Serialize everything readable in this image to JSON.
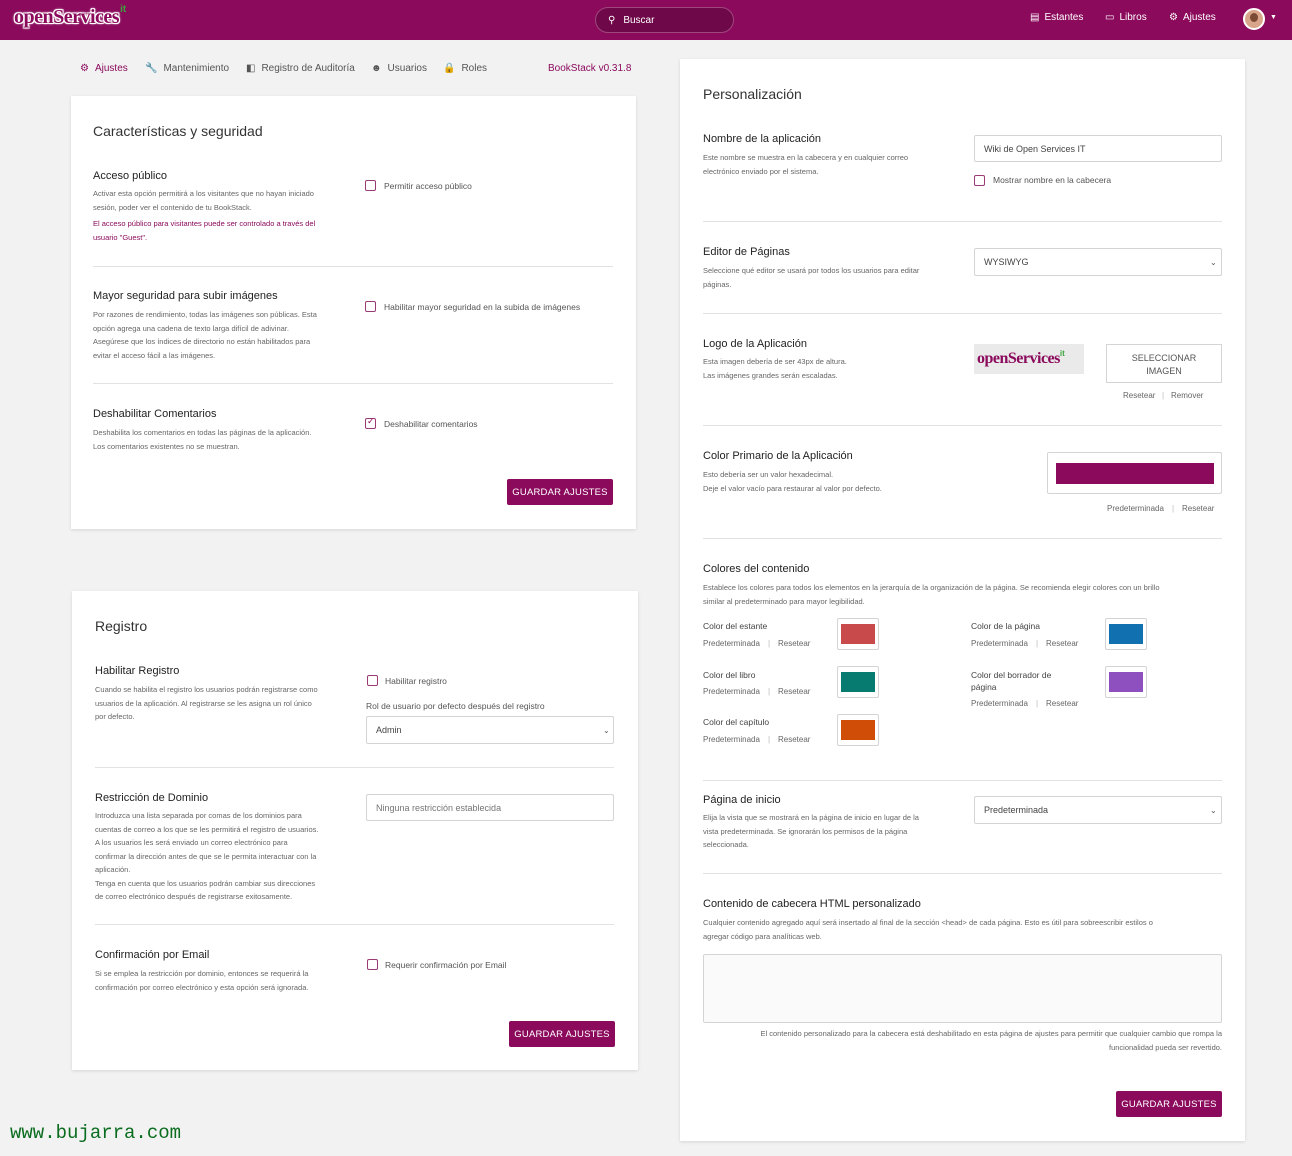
{
  "header": {
    "logo_text": "openServices",
    "logo_suffix": "it",
    "search_placeholder": "Buscar",
    "nav": [
      {
        "label": "Estantes",
        "icon": "shelves-icon"
      },
      {
        "label": "Libros",
        "icon": "books-icon"
      },
      {
        "label": "Ajustes",
        "icon": "gear-icon"
      }
    ]
  },
  "settings_nav": {
    "items": [
      {
        "label": "Ajustes",
        "icon": "gear-icon"
      },
      {
        "label": "Mantenimiento",
        "icon": "wrench-icon"
      },
      {
        "label": "Registro de Auditoría",
        "icon": "audit-log-icon"
      },
      {
        "label": "Usuarios",
        "icon": "users-icon"
      },
      {
        "label": "Roles",
        "icon": "lock-icon"
      }
    ],
    "version": "BookStack v0.31.8"
  },
  "features": {
    "title": "Características y seguridad",
    "public_access": {
      "title": "Acceso público",
      "desc": [
        "Activar esta opción permitirá a los visitantes que no hayan iniciado",
        "sesión, poder ver el contenido de tu BookStack."
      ],
      "note": [
        "El acceso público para visitantes puede ser controlado a través del",
        "usuario \"Guest\"."
      ],
      "checkbox_label": "Permitir acceso público",
      "checked": false
    },
    "image_security": {
      "title": "Mayor seguridad para subir imágenes",
      "desc": [
        "Por razones de rendimiento, todas las imágenes son públicas. Esta",
        "opción agrega una cadena de texto larga difícil de adivinar.",
        "Asegúrese que los índices de directorio no están habilitados para",
        "evitar el acceso fácil a las imágenes."
      ],
      "checkbox_label": "Habilitar mayor seguridad en la subida de imágenes",
      "checked": false
    },
    "disable_comments": {
      "title": "Deshabilitar Comentarios",
      "desc": [
        "Deshabilita los comentarios en todas las páginas de la aplicación.",
        "Los comentarios existentes no se muestran."
      ],
      "checkbox_label": "Deshabilitar comentarios",
      "checked": true
    },
    "save_label": "GUARDAR AJUSTES"
  },
  "registration": {
    "title": "Registro",
    "enable": {
      "title": "Habilitar Registro",
      "desc": [
        "Cuando se habilita el registro los usuarios podrán registrarse como",
        "usuarios de la aplicación. Al registrarse se les asigna un rol único",
        "por defecto."
      ],
      "checkbox_label": "Habilitar registro",
      "checked": false,
      "role_label": "Rol de usuario por defecto después del registro",
      "role_value": "Admin"
    },
    "domain": {
      "title": "Restricción de Dominio",
      "desc": [
        "Introduzca una lista separada por comas de los dominios para",
        "cuentas de correo a los que se les permitirá el registro de usuarios.",
        "A los usuarios les será enviado un correo electrónico para",
        "confirmar la dirección antes de que se le permita interactuar con la",
        "aplicación.",
        "Tenga en cuenta que los usuarios podrán cambiar sus direcciones",
        "de correo electrónico después de registrarse exitosamente."
      ],
      "placeholder": "Ninguna restricción establecida"
    },
    "email_confirm": {
      "title": "Confirmación por Email",
      "desc": [
        "Si se emplea la restricción por dominio, entonces se requerirá la",
        "confirmación por correo electrónico y esta opción será ignorada."
      ],
      "checkbox_label": "Requerir confirmación por Email",
      "checked": false
    },
    "save_label": "GUARDAR AJUSTES"
  },
  "customization": {
    "title": "Personalización",
    "app_name": {
      "title": "Nombre de la aplicación",
      "desc": [
        "Este nombre se muestra en la cabecera y en cualquier correo",
        "electrónico enviado por el sistema."
      ],
      "value": "Wiki de Open Services IT",
      "checkbox_label": "Mostrar nombre en la cabecera",
      "checked": false
    },
    "editor": {
      "title": "Editor de Páginas",
      "desc": [
        "Seleccione qué editor se usará por todos los usuarios para editar",
        "páginas."
      ],
      "value": "WYSIWYG"
    },
    "logo": {
      "title": "Logo de la Aplicación",
      "desc": [
        "Esta imagen debería de ser 43px de altura.",
        "Las imágenes grandes serán escaladas."
      ],
      "select_label": [
        "SELECCIONAR",
        "IMAGEN"
      ],
      "reset_label": "Resetear",
      "remove_label": "Remover"
    },
    "primary_color": {
      "title": "Color Primario de la Aplicación",
      "desc": [
        "Esto debería ser un valor hexadecimal.",
        "Deje el valor vacío para restaurar al valor por defecto."
      ],
      "color": "#8b0a5c",
      "default_label": "Predeterminada",
      "reset_label": "Resetear"
    },
    "content_colors": {
      "title": "Colores del contenido",
      "desc": [
        "Establece los colores para todos los elementos en la jerarquía de la organización de la página. Se recomienda elegir colores con un brillo",
        "similar al predeterminado para mayor legibilidad."
      ],
      "default_label": "Predeterminada",
      "reset_label": "Resetear",
      "items": [
        {
          "label": [
            "Color del estante"
          ],
          "color": "#c94a4a"
        },
        {
          "label": [
            "Color de la página"
          ],
          "color": "#1070b0"
        },
        {
          "label": [
            "Color del libro"
          ],
          "color": "#077b70"
        },
        {
          "label": [
            "Color del borrador de",
            "página"
          ],
          "color": "#8e4fbf"
        },
        {
          "label": [
            "Color del capítulo"
          ],
          "color": "#cf4d06"
        }
      ]
    },
    "homepage": {
      "title": "Página de inicio",
      "desc": [
        "Elija la vista que se mostrará en la página de inicio en lugar de la",
        "vista predeterminada. Se ignorarán los permisos de la página",
        "seleccionada."
      ],
      "value": "Predeterminada"
    },
    "custom_head": {
      "title": "Contenido de cabecera HTML personalizado",
      "desc": [
        "Cualquier contenido agregado aquí será insertado al final de la sección <head> de cada página. Esto es útil para sobreescribir estilos o",
        "agregar código para analíticas web."
      ],
      "note": [
        "El contenido personalizado para la cabecera está deshabilitado en esta página de ajustes para permitir que cualquier cambio que rompa la",
        "funcionalidad pueda ser revertido."
      ]
    },
    "save_label": "GUARDAR AJUSTES"
  },
  "watermark": "www.bujarra.com"
}
